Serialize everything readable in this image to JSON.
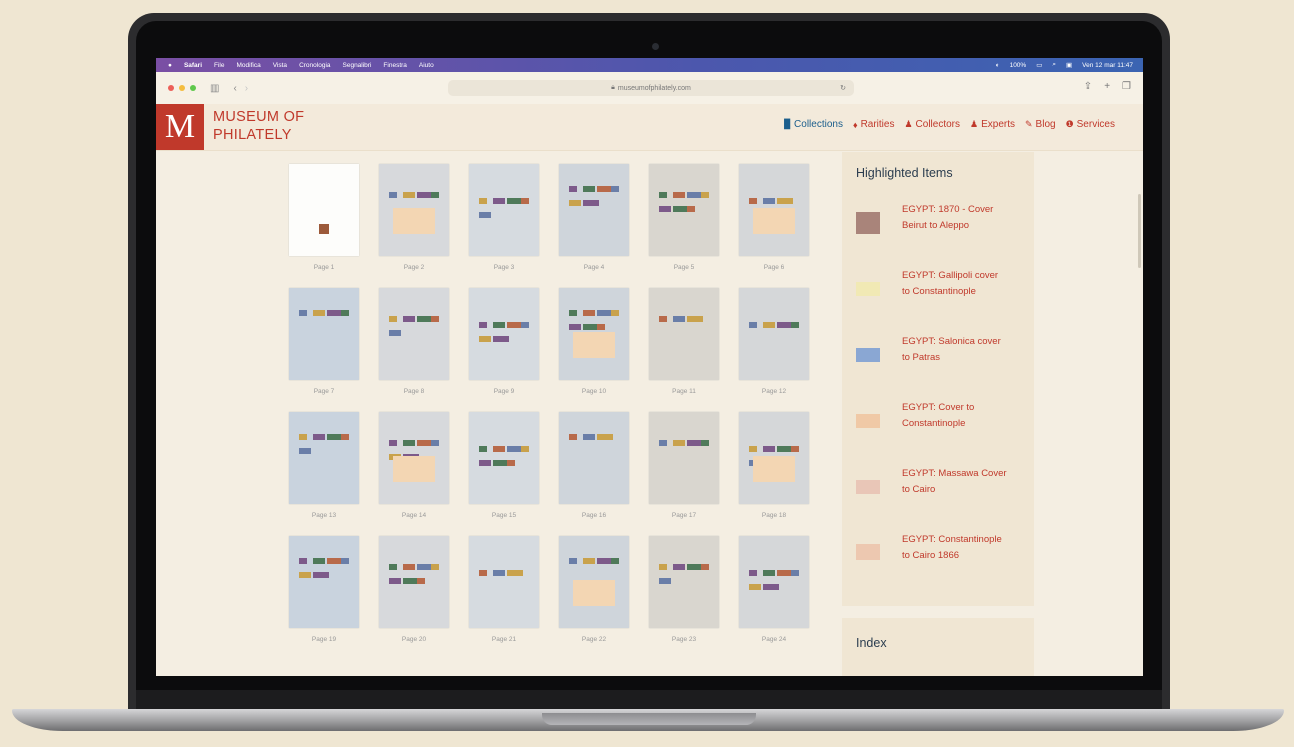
{
  "menubar": {
    "apple": "",
    "items": [
      "Safari",
      "File",
      "Modifica",
      "Vista",
      "Cronologia",
      "Segnalibri",
      "Finestra",
      "Aiuto"
    ],
    "status": [
      "100%",
      "Ven 12 mar 11:47"
    ]
  },
  "browser": {
    "url": "museumofphilately.com"
  },
  "site": {
    "logo_letter": "M",
    "logo_line1": "MUSEUM OF",
    "logo_line2": "PHILATELY",
    "nav": [
      {
        "label": "Collections",
        "icon": "book-icon",
        "glyph": "▉"
      },
      {
        "label": "Rarities",
        "icon": "gem-icon",
        "glyph": "♦"
      },
      {
        "label": "Collectors",
        "icon": "user-icon",
        "glyph": "♟"
      },
      {
        "label": "Experts",
        "icon": "user-icon",
        "glyph": "♟"
      },
      {
        "label": "Blog",
        "icon": "pen-icon",
        "glyph": "✎"
      },
      {
        "label": "Services",
        "icon": "info-icon",
        "glyph": "❶"
      }
    ]
  },
  "pages": [
    "Page 1",
    "Page 2",
    "Page 3",
    "Page 4",
    "Page 5",
    "Page 6",
    "Page 7",
    "Page 8",
    "Page 9",
    "Page 10",
    "Page 11",
    "Page 12",
    "Page 13",
    "Page 14",
    "Page 15",
    "Page 16",
    "Page 17",
    "Page 18",
    "Page 19",
    "Page 20",
    "Page 21",
    "Page 22",
    "Page 23",
    "Page 24"
  ],
  "sidebar": {
    "title": "Highlighted Items",
    "items": [
      {
        "line1": "EGYPT: 1870 - Cover",
        "line2": "Beirut to Aleppo"
      },
      {
        "line1": "EGYPT: Gallipoli cover",
        "line2": "to Constantinople"
      },
      {
        "line1": "EGYPT: Salonica cover",
        "line2": "to Patras"
      },
      {
        "line1": "EGYPT: Cover to",
        "line2": "Constantinople"
      },
      {
        "line1": "EGYPT: Massawa Cover",
        "line2": "to Cairo"
      },
      {
        "line1": "EGYPT: Constantinople",
        "line2": "to Cairo 1866"
      }
    ],
    "index_title": "Index"
  },
  "colors": {
    "brand_red": "#c0392b",
    "active_blue": "#1b5e8c",
    "background": "#f4eee2"
  }
}
